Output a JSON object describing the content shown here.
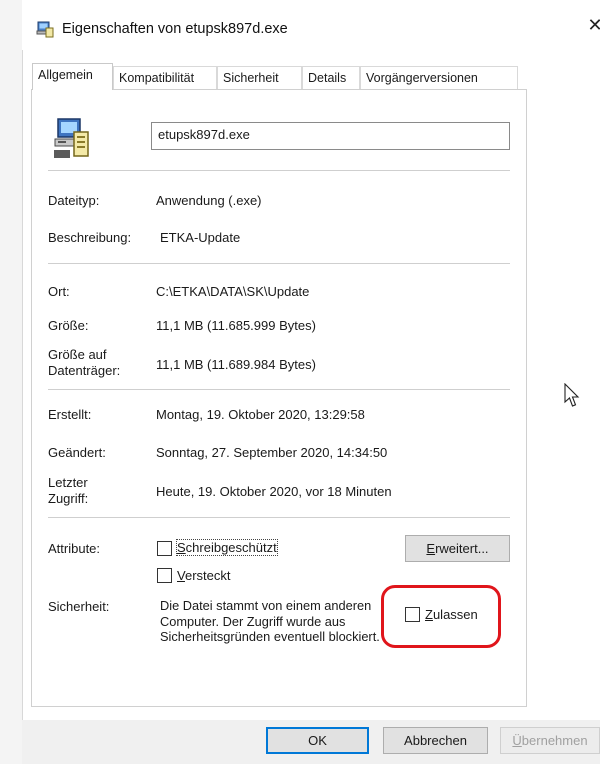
{
  "window": {
    "title": "Eigenschaften von etupsk897d.exe",
    "close_label": "✕",
    "icon": "program-file-icon"
  },
  "tabs": [
    {
      "label": "Allgemein",
      "active": true
    },
    {
      "label": "Kompatibilität",
      "active": false
    },
    {
      "label": "Sicherheit",
      "active": false
    },
    {
      "label": "Details",
      "active": false
    },
    {
      "label": "Vorgängerversionen",
      "active": false
    }
  ],
  "general": {
    "filename": "etupsk897d.exe",
    "file_icon": "program-file-icon",
    "dateityp_label": "Dateityp:",
    "dateityp_value": "Anwendung (.exe)",
    "beschreibung_label": "Beschreibung:",
    "beschreibung_value": "ETKA-Update",
    "ort_label": "Ort:",
    "ort_value": "C:\\ETKA\\DATA\\SK\\Update",
    "groesse_label": "Größe:",
    "groesse_value": "11,1 MB (11.685.999 Bytes)",
    "groesse_auf_label_1": "Größe auf",
    "groesse_auf_label_2": "Datenträger:",
    "groesse_auf_value": "11,1 MB (11.689.984 Bytes)",
    "erstellt_label": "Erstellt:",
    "erstellt_value": "Montag, 19. Oktober 2020, 13:29:58",
    "geaendert_label": "Geändert:",
    "geaendert_value": "Sonntag, 27. September 2020, 14:34:50",
    "zugriff_label_1": "Letzter",
    "zugriff_label_2": "Zugriff:",
    "zugriff_value": "Heute, 19. Oktober 2020, vor 18 Minuten",
    "attribute_label": "Attribute:",
    "schreibgeschuetzt_label": "Schreibgeschützt",
    "versteckt_label": "Versteckt",
    "erweitert_label": "Erweitert...",
    "sicherheit_label": "Sicherheit:",
    "sicherheit_text": "Die Datei stammt von einem anderen Computer. Der Zugriff wurde aus Sicherheitsgründen eventuell blockiert.",
    "zulassen_label": "Zulassen"
  },
  "buttons": {
    "ok": "OK",
    "abbrechen": "Abbrechen",
    "uebernehmen": "Übernehmen"
  },
  "colors": {
    "highlight_ring": "#e0151b",
    "default_button_border": "#0078d7"
  }
}
